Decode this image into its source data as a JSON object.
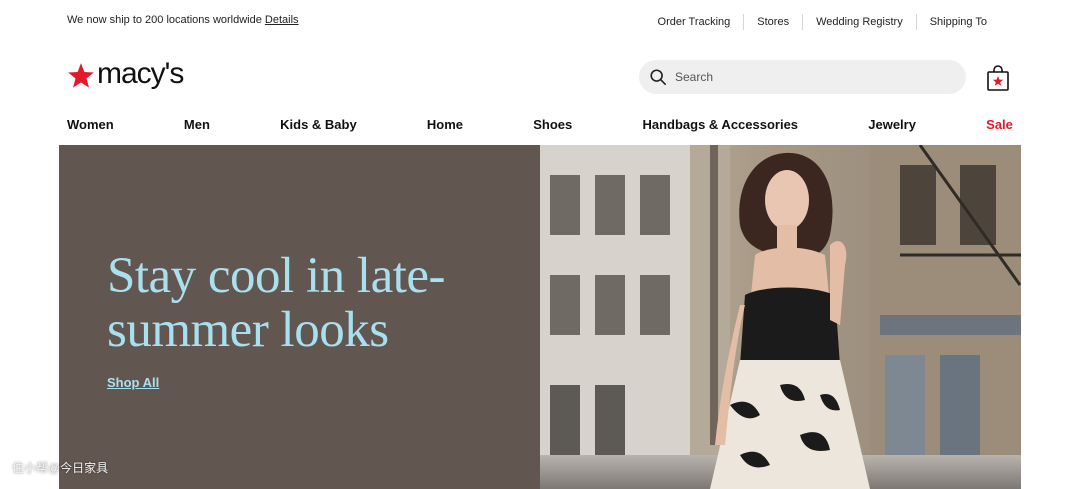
{
  "utility_bar": {
    "shipping_message": "We now ship to 200 locations worldwide",
    "details_link": "Details",
    "links": [
      "Order Tracking",
      "Stores",
      "Wedding Registry",
      "Shipping To"
    ]
  },
  "header": {
    "logo_text": "macy's",
    "search_placeholder": "Search"
  },
  "nav": {
    "items": [
      "Women",
      "Men",
      "Kids & Baby",
      "Home",
      "Shoes",
      "Handbags & Accessories",
      "Jewelry",
      "Sale"
    ]
  },
  "hero": {
    "heading": "Stay cool in late-summer looks",
    "cta": "Shop All"
  },
  "watermark": "住小帮@今日家具",
  "colors": {
    "brand_red": "#e21a2c",
    "hero_panel": "#625650",
    "hero_text": "#a9e0ef"
  },
  "icons": [
    "star-logo-icon",
    "search-icon",
    "shopping-bag-icon"
  ]
}
